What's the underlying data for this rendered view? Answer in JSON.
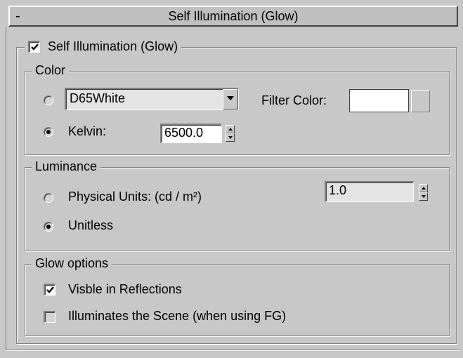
{
  "rollout": {
    "collapse_symbol": "-",
    "title": "Self Illumination (Glow)"
  },
  "self_illum": {
    "label": "Self Illumination (Glow)",
    "checked": true
  },
  "color_group": {
    "legend": "Color",
    "preset_dropdown": {
      "value": "D65White",
      "selected": false
    },
    "filter_color_label": "Filter Color:",
    "filter_color_value": "#ffffff",
    "kelvin": {
      "label": "Kelvin:",
      "selected": true,
      "value": "6500.0"
    }
  },
  "luminance_group": {
    "legend": "Luminance",
    "physical_units": {
      "label": "Physical Units: (cd / m²)",
      "selected": false
    },
    "unitless": {
      "label": "Unitless",
      "selected": true
    },
    "value": "1.0"
  },
  "glow_group": {
    "legend": "Glow options",
    "visible_in_reflections": {
      "label": "Visble in Reflections",
      "checked": true
    },
    "illuminates_scene": {
      "label": "Illuminates the Scene (when using FG)",
      "checked": false
    }
  }
}
